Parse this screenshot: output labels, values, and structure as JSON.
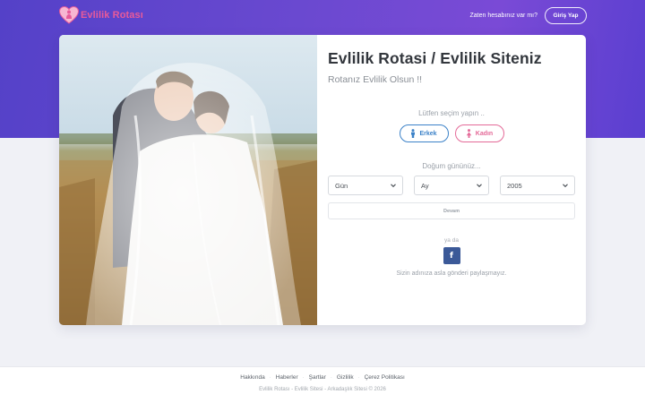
{
  "header": {
    "logo_text": "Evlilik Rotası",
    "have_account": "Zaten hesabınız var mı?",
    "login_label": "Giriş Yap"
  },
  "main": {
    "title": "Evlilik Rotasi / Evlilik Siteniz",
    "subtitle": "Rotanız Evlilik Olsun !!",
    "gender_prompt": "Lütfen seçim yapın ..",
    "gender_options": [
      {
        "label": "Erkek",
        "icon": "male-icon"
      },
      {
        "label": "Kadın",
        "icon": "female-icon"
      }
    ],
    "dob_prompt": "Doğum gününüz...",
    "day_value": "Gün",
    "month_value": "Ay",
    "year_value": "2005",
    "continue_label": "Devam",
    "or_text": "ya da",
    "facebook_icon": "facebook-icon",
    "privacy_note": "Sizin adınıza asla gönderi paylaşmayız."
  },
  "footer": {
    "links": [
      "Hakkında",
      "Haberler",
      "Şartlar",
      "Gizlilik",
      "Çerez Politikası"
    ],
    "copyright": "Evlilik Rotası - Evlilik Sitesi - Arkadaşlık Sitesi © 2026"
  },
  "colors": {
    "hero_gradient_start": "#5441c8",
    "hero_gradient_end": "#7a4ad6",
    "male_accent": "#3c82c8",
    "female_accent": "#e46a98",
    "logo_pink": "#e85a9a",
    "facebook_blue": "#3b5998"
  }
}
